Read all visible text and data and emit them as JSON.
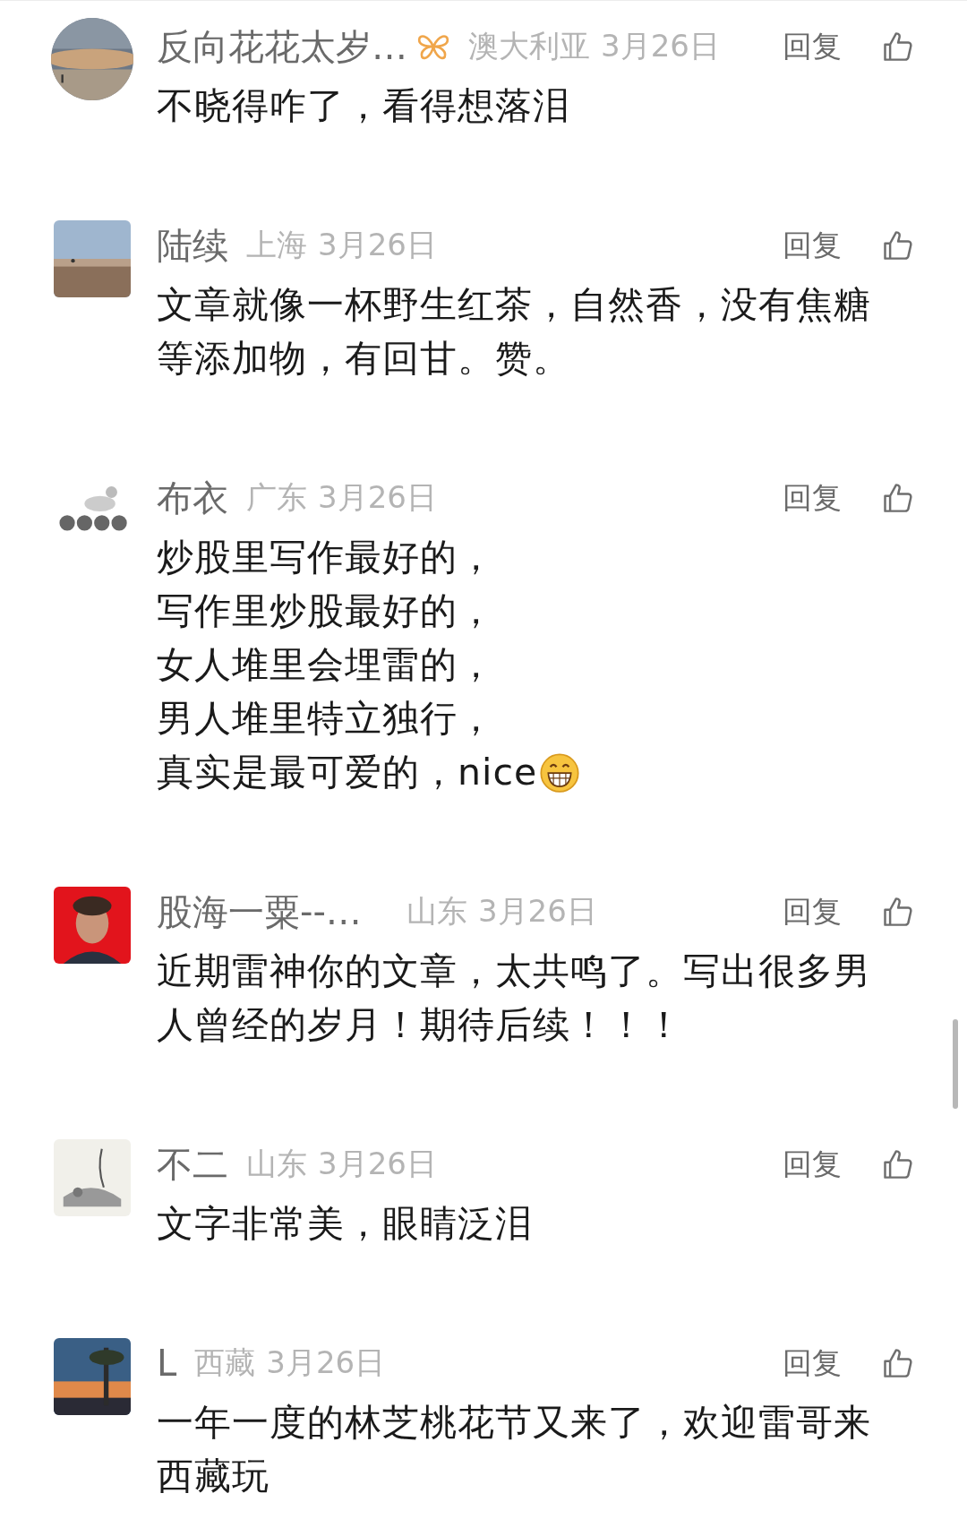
{
  "comments": [
    {
      "name": "反向花花太岁…",
      "badge": true,
      "location": "澳大利亚",
      "date": "3月26日",
      "reply": "回复",
      "lines": [
        "不晓得咋了，看得想落泪"
      ]
    },
    {
      "name": "陆续",
      "location": "上海",
      "date": "3月26日",
      "reply": "回复",
      "lines": [
        "文章就像一杯野生红茶，自然香，没有焦糖",
        "等添加物，有回甘。赞。"
      ]
    },
    {
      "name": "布衣",
      "location": "广东",
      "date": "3月26日",
      "reply": "回复",
      "lines": [
        "炒股里写作最好的，",
        "写作里炒股最好的，",
        "女人堆里会埋雷的，",
        "男人堆里特立独行，",
        "真实是最可爱的，nice"
      ],
      "trailing_emoji": true
    },
    {
      "name": "股海一粟--…",
      "location": "山东",
      "date": "3月26日",
      "reply": "回复",
      "lines": [
        "近期雷神你的文章，太共鸣了。写出很多男",
        "人曾经的岁月！期待后续！！！"
      ]
    },
    {
      "name": "不二",
      "location": "山东",
      "date": "3月26日",
      "reply": "回复",
      "lines": [
        "文字非常美，眼睛泛泪"
      ]
    },
    {
      "name": "L",
      "location": "西藏",
      "date": "3月26日",
      "reply": "回复",
      "lines": [
        "一年一度的林芝桃花节又来了，欢迎雷哥来",
        "西藏玩"
      ]
    }
  ]
}
